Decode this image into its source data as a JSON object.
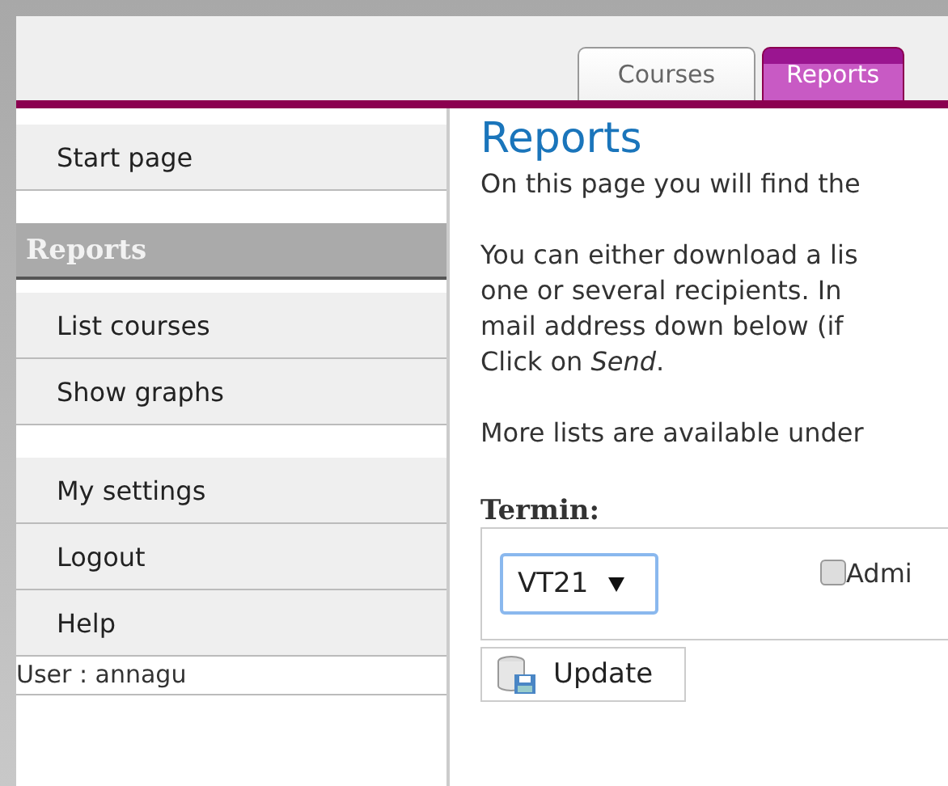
{
  "tabs": [
    {
      "label": "Courses",
      "selected": false
    },
    {
      "label": "Reports",
      "selected": true
    }
  ],
  "sidebar": {
    "groups": [
      {
        "items": [
          {
            "label": "Start page",
            "kind": "link"
          }
        ]
      },
      {
        "items": [
          {
            "label": "Reports",
            "kind": "heading"
          },
          {
            "label": "List courses",
            "kind": "link"
          },
          {
            "label": "Show graphs",
            "kind": "link"
          }
        ]
      },
      {
        "items": [
          {
            "label": "My settings",
            "kind": "link"
          },
          {
            "label": "Logout",
            "kind": "link"
          },
          {
            "label": "Help",
            "kind": "link"
          }
        ]
      }
    ],
    "user": "User : annagu"
  },
  "content": {
    "title": "Reports",
    "paragraphs": [
      [
        "On this page you will find the"
      ],
      [
        "You can either download a lis",
        "one or several recipients. In",
        "mail address down below (if",
        "Click on *Send*."
      ],
      [
        "More lists are available under"
      ]
    ],
    "termin": {
      "label": "Termin:",
      "select": "VT21",
      "checkbox": {
        "label": "Admi",
        "checked": false
      }
    },
    "update_button": "Update"
  }
}
